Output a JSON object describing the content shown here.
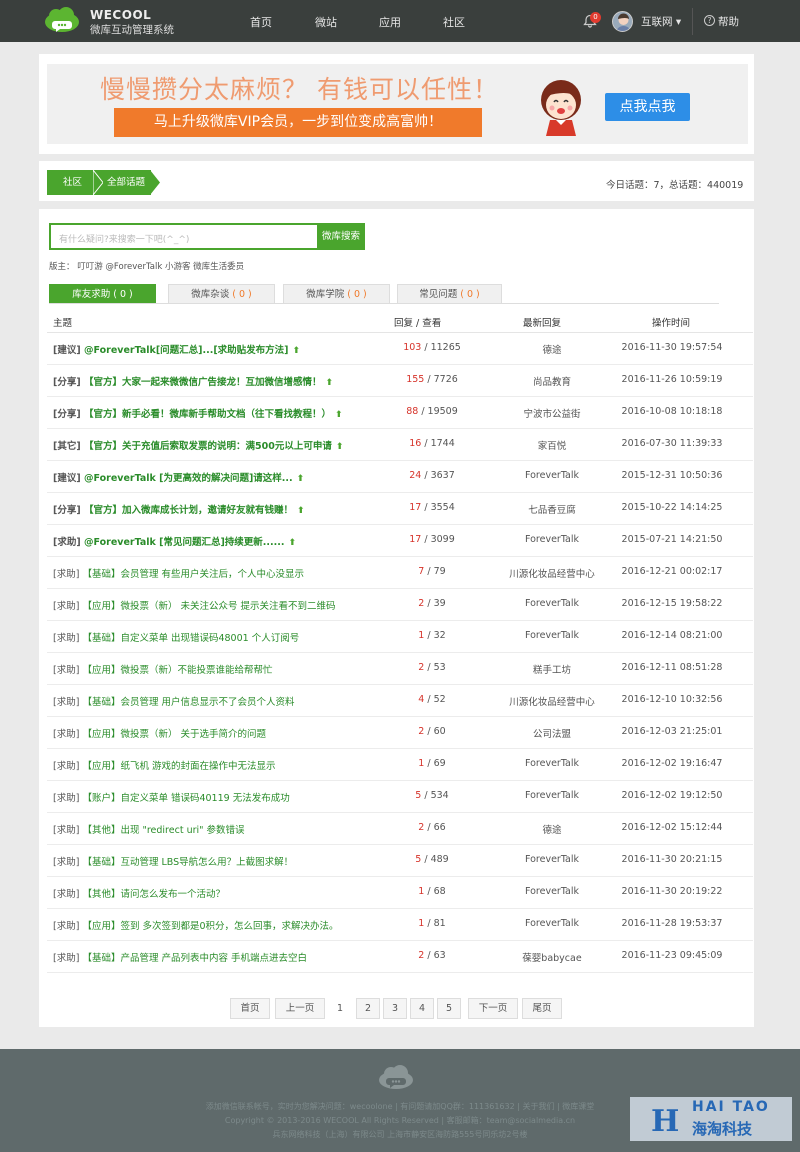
{
  "header": {
    "brand_en": "WECOOL",
    "brand_cn": "微库互动管理系统",
    "nav": [
      "首页",
      "微站",
      "应用",
      "社区"
    ],
    "notif_count": "0",
    "user": "互联网",
    "user_caret": "▾",
    "help": "帮助",
    "help_icon": "?"
  },
  "banner": {
    "headline": "慢慢攒分太麻烦？ 有钱可以任性！",
    "subline": "马上升级微库VIP会员，一步到位变成高富帅！",
    "cta": "点我点我"
  },
  "breadcrumb": {
    "level1": "社区",
    "level2": "全部话题"
  },
  "stats": "今日话题：7，总话题：440019",
  "search": {
    "placeholder": "有什么疑问?来搜索一下吧(^_^)",
    "button": "微库搜索"
  },
  "moderators": "版主： 叮叮游  @ForeverTalk  小游客  微库生活委员",
  "tabs": [
    {
      "label": "库友求助",
      "count": "( 0 )"
    },
    {
      "label": "微库杂谈",
      "count": "( 0 )"
    },
    {
      "label": "微库学院",
      "count": "( 0 )"
    },
    {
      "label": "常见问题",
      "count": "( 0 )"
    }
  ],
  "columns": {
    "topic": "主题",
    "reply_view": "回复 / 查看",
    "last_reply": "最新回复",
    "time": "操作时间"
  },
  "rows": [
    {
      "tag": "[建议]",
      "title": "@ForeverTalk[问题汇总]...[求助贴发布方法]",
      "replies": "103",
      "views": " / 11265",
      "last": "德途",
      "time": "2016-11-30 19:57:54"
    },
    {
      "tag": "[分享]",
      "title": "【官方】大家一起来微微信广告接龙！互加微信增感情！",
      "replies": "155",
      "views": " / 7726",
      "last": "尚品教育",
      "time": "2016-11-26 10:59:19"
    },
    {
      "tag": "[分享]",
      "title": "【官方】新手必看！微库新手帮助文档（往下看找教程！）",
      "replies": "88",
      "views": " / 19509",
      "last": "宁波市公益街",
      "time": "2016-10-08 10:18:18"
    },
    {
      "tag": "[其它]",
      "title": "【官方】关于充值后索取发票的说明：满500元以上可申请",
      "replies": "16",
      "views": " / 1744",
      "last": "家百悦",
      "time": "2016-07-30 11:39:33"
    },
    {
      "tag": "[建议]",
      "title": "@ForeverTalk [为更高效的解决问题]请这样...",
      "replies": "24",
      "views": " / 3637",
      "last": "ForeverTalk",
      "time": "2015-12-31 10:50:36"
    },
    {
      "tag": "[分享]",
      "title": "【官方】加入微库成长计划，邀请好友就有钱赚！",
      "replies": "17",
      "views": " / 3554",
      "last": "七品香豆腐",
      "time": "2015-10-22 14:14:25"
    },
    {
      "tag": "[求助]",
      "title": "@ForeverTalk [常见问题汇总]持续更新......",
      "replies": "17",
      "views": " / 3099",
      "last": "ForeverTalk",
      "time": "2015-07-21 14:21:50"
    },
    {
      "tag": "[求助]",
      "title": "【基础】会员管理 有些用户关注后，个人中心没显示",
      "replies": "7",
      "views": " / 79",
      "last": "川源化妆品经营中心",
      "time": "2016-12-21 00:02:17"
    },
    {
      "tag": "[求助]",
      "title": "【应用】微投票（新） 未关注公众号 提示关注看不到二维码",
      "replies": "2",
      "views": " / 39",
      "last": "ForeverTalk",
      "time": "2016-12-15 19:58:22"
    },
    {
      "tag": "[求助]",
      "title": "【基础】自定义菜单 出现错误码48001 个人订阅号",
      "replies": "1",
      "views": " / 32",
      "last": "ForeverTalk",
      "time": "2016-12-14 08:21:00"
    },
    {
      "tag": "[求助]",
      "title": "【应用】微投票（新）不能投票谁能给帮帮忙",
      "replies": "2",
      "views": " / 53",
      "last": "糕手工坊",
      "time": "2016-12-11 08:51:28"
    },
    {
      "tag": "[求助]",
      "title": "【基础】会员管理 用户信息显示不了会员个人资料",
      "replies": "4",
      "views": " / 52",
      "last": "川源化妆品经营中心",
      "time": "2016-12-10 10:32:56"
    },
    {
      "tag": "[求助]",
      "title": "【应用】微投票（新） 关于选手简介的问题",
      "replies": "2",
      "views": " / 60",
      "last": "公司法盟",
      "time": "2016-12-03 21:25:01"
    },
    {
      "tag": "[求助]",
      "title": "【应用】纸飞机 游戏的封面在操作中无法显示",
      "replies": "1",
      "views": " / 69",
      "last": "ForeverTalk",
      "time": "2016-12-02 19:16:47"
    },
    {
      "tag": "[求助]",
      "title": "【账户】自定义菜单 错误码40119 无法发布成功",
      "replies": "5",
      "views": " / 534",
      "last": "ForeverTalk",
      "time": "2016-12-02 19:12:50"
    },
    {
      "tag": "[求助]",
      "title": "【其他】出现 \"redirect uri\" 参数错误",
      "replies": "2",
      "views": " / 66",
      "last": "德途",
      "time": "2016-12-02 15:12:44"
    },
    {
      "tag": "[求助]",
      "title": "【基础】互动管理 LBS导航怎么用？上截图求解！",
      "replies": "5",
      "views": " / 489",
      "last": "ForeverTalk",
      "time": "2016-11-30 20:21:15"
    },
    {
      "tag": "[求助]",
      "title": "【其他】请问怎么发布一个活动？",
      "replies": "1",
      "views": " / 68",
      "last": "ForeverTalk",
      "time": "2016-11-30 20:19:22"
    },
    {
      "tag": "[求助]",
      "title": "【应用】签到 多次签到都是0积分，怎么回事，求解决办法。",
      "replies": "1",
      "views": " / 81",
      "last": "ForeverTalk",
      "time": "2016-11-28 19:53:37"
    },
    {
      "tag": "[求助]",
      "title": "【基础】产品管理 产品列表中内容 手机端点进去空白",
      "replies": "2",
      "views": " / 63",
      "last": "葆婴babycae",
      "time": "2016-11-23 09:45:09"
    }
  ],
  "pagination": [
    "首页",
    "上一页",
    "1",
    "2",
    "3",
    "4",
    "5",
    "下一页",
    "尾页"
  ],
  "footer": {
    "line1": "添加微信联系帐号，实时为您解决问题：wecoolone | 有问题请加QQ群：111361632 | 关于我们 | 微库课堂",
    "line2": "Copyright © 2013-2016 WECOOL All Rights Reserved | 客服邮箱：team@socialmedia.cn",
    "line3": "兵东网络科技（上海）有限公司 上海市静安区海防路555号同乐坊2号楼"
  },
  "watermark": {
    "en": "HAI TAO",
    "cn": "海淘科技",
    "letter": "H"
  },
  "colors": {
    "topbar": "#3a3f3d",
    "accent": "#4aa52d",
    "reply_count": "#d6332a",
    "banner_orange": "#f07a2b",
    "cta_blue": "#2d8ee7",
    "footer": "#5f6a6b"
  }
}
